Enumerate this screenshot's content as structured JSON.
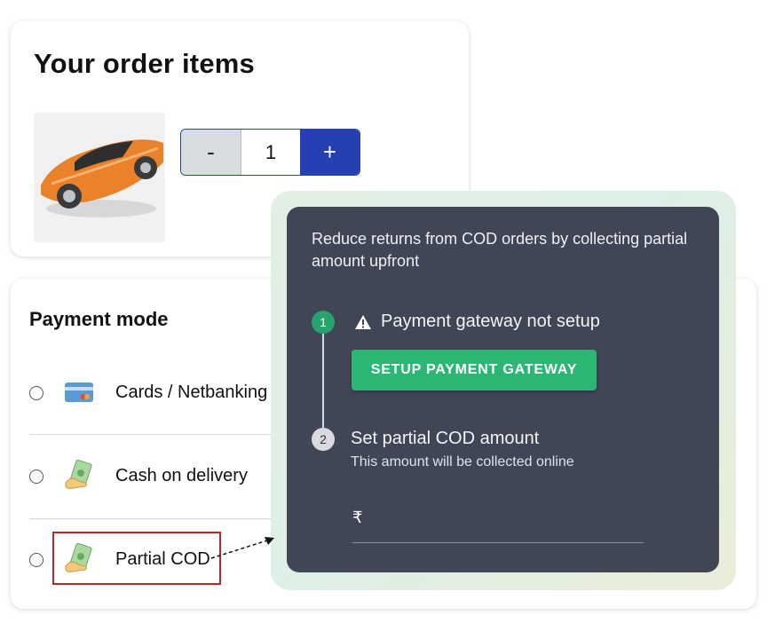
{
  "order": {
    "title": "Your order items",
    "quantity": "1",
    "minus_label": "-",
    "plus_label": "+"
  },
  "payment": {
    "title": "Payment mode",
    "options": [
      {
        "label": "Cards / Netbanking",
        "icon": "credit-card-icon"
      },
      {
        "label": "Cash on delivery",
        "icon": "cash-hand-icon"
      },
      {
        "label": "Partial COD",
        "icon": "cash-hand-icon"
      }
    ]
  },
  "popup": {
    "description": "Reduce returns from COD orders by collecting partial amount upfront",
    "step1": {
      "number": "1",
      "text": "Payment gateway not setup",
      "button": "SETUP PAYMENT GATEWAY"
    },
    "step2": {
      "number": "2",
      "title": "Set partial COD amount",
      "subtitle": "This amount will be collected online"
    },
    "currency_symbol": "₹"
  },
  "colors": {
    "accent_blue": "#2540b3",
    "popup_bg": "#404656",
    "success_green": "#2bb673",
    "highlight_red": "#b42a2a"
  }
}
